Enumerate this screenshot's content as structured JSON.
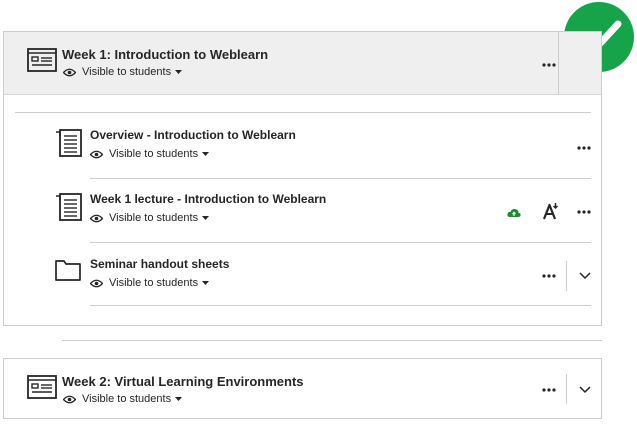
{
  "modules": [
    {
      "title": "Week 1: Introduction to Weblearn",
      "visibility": "Visible to students",
      "items": [
        {
          "title": "Overview - Introduction to Weblearn",
          "visibility": "Visible to students",
          "icon": "document-icon"
        },
        {
          "title": "Week 1 lecture - Introduction to Weblearn",
          "visibility": "Visible to students",
          "icon": "document-icon"
        },
        {
          "title": "Seminar handout sheets",
          "visibility": "Visible to students",
          "icon": "folder-icon"
        }
      ]
    },
    {
      "title": "Week 2: Virtual Learning Environments",
      "visibility": "Visible to students",
      "items": []
    }
  ],
  "colors": {
    "success_badge": "#16a34a",
    "online_indicator": "#1e8a2e",
    "header_bg": "#efefef",
    "border": "#cdcdcd"
  },
  "icons": [
    "module-icon",
    "eye-icon",
    "caret-down-icon",
    "more-options-icon",
    "chevron-down-icon",
    "document-icon",
    "folder-icon",
    "cloud-upload-icon",
    "accessibility-icon",
    "checkmark-icon"
  ]
}
